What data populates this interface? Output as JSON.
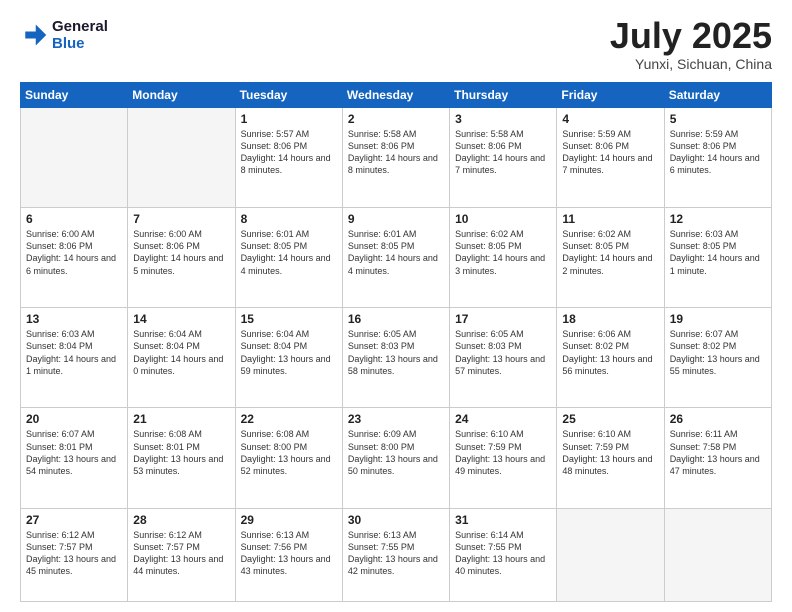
{
  "header": {
    "logo_line1": "General",
    "logo_line2": "Blue",
    "month": "July 2025",
    "location": "Yunxi, Sichuan, China"
  },
  "weekdays": [
    "Sunday",
    "Monday",
    "Tuesday",
    "Wednesday",
    "Thursday",
    "Friday",
    "Saturday"
  ],
  "weeks": [
    [
      {
        "day": "",
        "empty": true
      },
      {
        "day": "",
        "empty": true
      },
      {
        "day": "1",
        "sunrise": "5:57 AM",
        "sunset": "8:06 PM",
        "daylight": "14 hours and 8 minutes."
      },
      {
        "day": "2",
        "sunrise": "5:58 AM",
        "sunset": "8:06 PM",
        "daylight": "14 hours and 8 minutes."
      },
      {
        "day": "3",
        "sunrise": "5:58 AM",
        "sunset": "8:06 PM",
        "daylight": "14 hours and 7 minutes."
      },
      {
        "day": "4",
        "sunrise": "5:59 AM",
        "sunset": "8:06 PM",
        "daylight": "14 hours and 7 minutes."
      },
      {
        "day": "5",
        "sunrise": "5:59 AM",
        "sunset": "8:06 PM",
        "daylight": "14 hours and 6 minutes."
      }
    ],
    [
      {
        "day": "6",
        "sunrise": "6:00 AM",
        "sunset": "8:06 PM",
        "daylight": "14 hours and 6 minutes."
      },
      {
        "day": "7",
        "sunrise": "6:00 AM",
        "sunset": "8:06 PM",
        "daylight": "14 hours and 5 minutes."
      },
      {
        "day": "8",
        "sunrise": "6:01 AM",
        "sunset": "8:05 PM",
        "daylight": "14 hours and 4 minutes."
      },
      {
        "day": "9",
        "sunrise": "6:01 AM",
        "sunset": "8:05 PM",
        "daylight": "14 hours and 4 minutes."
      },
      {
        "day": "10",
        "sunrise": "6:02 AM",
        "sunset": "8:05 PM",
        "daylight": "14 hours and 3 minutes."
      },
      {
        "day": "11",
        "sunrise": "6:02 AM",
        "sunset": "8:05 PM",
        "daylight": "14 hours and 2 minutes."
      },
      {
        "day": "12",
        "sunrise": "6:03 AM",
        "sunset": "8:05 PM",
        "daylight": "14 hours and 1 minute."
      }
    ],
    [
      {
        "day": "13",
        "sunrise": "6:03 AM",
        "sunset": "8:04 PM",
        "daylight": "14 hours and 1 minute."
      },
      {
        "day": "14",
        "sunrise": "6:04 AM",
        "sunset": "8:04 PM",
        "daylight": "14 hours and 0 minutes."
      },
      {
        "day": "15",
        "sunrise": "6:04 AM",
        "sunset": "8:04 PM",
        "daylight": "13 hours and 59 minutes."
      },
      {
        "day": "16",
        "sunrise": "6:05 AM",
        "sunset": "8:03 PM",
        "daylight": "13 hours and 58 minutes."
      },
      {
        "day": "17",
        "sunrise": "6:05 AM",
        "sunset": "8:03 PM",
        "daylight": "13 hours and 57 minutes."
      },
      {
        "day": "18",
        "sunrise": "6:06 AM",
        "sunset": "8:02 PM",
        "daylight": "13 hours and 56 minutes."
      },
      {
        "day": "19",
        "sunrise": "6:07 AM",
        "sunset": "8:02 PM",
        "daylight": "13 hours and 55 minutes."
      }
    ],
    [
      {
        "day": "20",
        "sunrise": "6:07 AM",
        "sunset": "8:01 PM",
        "daylight": "13 hours and 54 minutes."
      },
      {
        "day": "21",
        "sunrise": "6:08 AM",
        "sunset": "8:01 PM",
        "daylight": "13 hours and 53 minutes."
      },
      {
        "day": "22",
        "sunrise": "6:08 AM",
        "sunset": "8:00 PM",
        "daylight": "13 hours and 52 minutes."
      },
      {
        "day": "23",
        "sunrise": "6:09 AM",
        "sunset": "8:00 PM",
        "daylight": "13 hours and 50 minutes."
      },
      {
        "day": "24",
        "sunrise": "6:10 AM",
        "sunset": "7:59 PM",
        "daylight": "13 hours and 49 minutes."
      },
      {
        "day": "25",
        "sunrise": "6:10 AM",
        "sunset": "7:59 PM",
        "daylight": "13 hours and 48 minutes."
      },
      {
        "day": "26",
        "sunrise": "6:11 AM",
        "sunset": "7:58 PM",
        "daylight": "13 hours and 47 minutes."
      }
    ],
    [
      {
        "day": "27",
        "sunrise": "6:12 AM",
        "sunset": "7:57 PM",
        "daylight": "13 hours and 45 minutes."
      },
      {
        "day": "28",
        "sunrise": "6:12 AM",
        "sunset": "7:57 PM",
        "daylight": "13 hours and 44 minutes."
      },
      {
        "day": "29",
        "sunrise": "6:13 AM",
        "sunset": "7:56 PM",
        "daylight": "13 hours and 43 minutes."
      },
      {
        "day": "30",
        "sunrise": "6:13 AM",
        "sunset": "7:55 PM",
        "daylight": "13 hours and 42 minutes."
      },
      {
        "day": "31",
        "sunrise": "6:14 AM",
        "sunset": "7:55 PM",
        "daylight": "13 hours and 40 minutes."
      },
      {
        "day": "",
        "empty": true
      },
      {
        "day": "",
        "empty": true
      }
    ]
  ]
}
